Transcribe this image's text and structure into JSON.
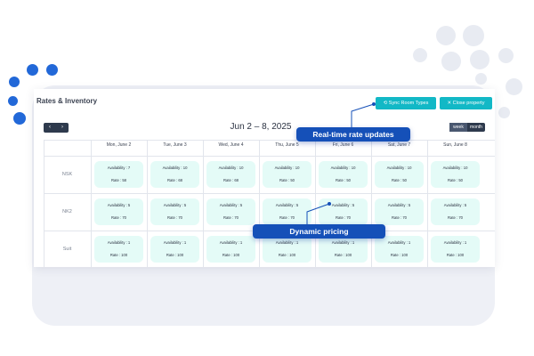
{
  "app": {
    "title": "Rates & Inventory",
    "sync_label": "⟲ Sync Room Types",
    "close_label": "✕ Close property"
  },
  "calendar": {
    "prev_icon": "‹",
    "next_icon": "›",
    "date_range": "Jun 2 – 8, 2025",
    "views": [
      "week",
      "month"
    ],
    "active_view": "week",
    "days": [
      "Mon, June 2",
      "Tue, June 3",
      "Wed, June 4",
      "Thu, June 5",
      "Fri, June 6",
      "Sat, June 7",
      "Sun, June 8"
    ]
  },
  "rows": [
    {
      "room": "NSK",
      "cells": [
        {
          "availability": "Availability : 7",
          "rate": "Rate : 58"
        },
        {
          "availability": "Availability : 10",
          "rate": "Rate : 68"
        },
        {
          "availability": "Availability : 10",
          "rate": "Rate : 68"
        },
        {
          "availability": "Availability : 10",
          "rate": "Rate : 50"
        },
        {
          "availability": "Availability : 10",
          "rate": "Rate : 50"
        },
        {
          "availability": "Availability : 10",
          "rate": "Rate : 50"
        },
        {
          "availability": "Availability : 10",
          "rate": "Rate : 50"
        }
      ]
    },
    {
      "room": "NK2",
      "cells": [
        {
          "availability": "Availability : 5",
          "rate": "Rate : 70"
        },
        {
          "availability": "Availability : 5",
          "rate": "Rate : 70"
        },
        {
          "availability": "Availability : 5",
          "rate": "Rate : 70"
        },
        {
          "availability": "Availability : 5",
          "rate": "Rate : 70"
        },
        {
          "availability": "Availability : 5",
          "rate": "Rate : 70"
        },
        {
          "availability": "Availability : 5",
          "rate": "Rate : 70"
        },
        {
          "availability": "Availability : 5",
          "rate": "Rate : 70"
        }
      ]
    },
    {
      "room": "Suit",
      "cells": [
        {
          "availability": "Availability : 1",
          "rate": "Rate : 100"
        },
        {
          "availability": "Availability : 1",
          "rate": "Rate : 100"
        },
        {
          "availability": "Availability : 1",
          "rate": "Rate : 100"
        },
        {
          "availability": "Availability : 1",
          "rate": "Rate : 100"
        },
        {
          "availability": "Availability : 1",
          "rate": "Rate : 100"
        },
        {
          "availability": "Availability : 1",
          "rate": "Rate : 100"
        },
        {
          "availability": "Availability : 1",
          "rate": "Rate : 100"
        }
      ]
    }
  ],
  "callouts": {
    "rate_updates": "Real-time rate updates",
    "dynamic_pricing": "Dynamic pricing"
  },
  "colors": {
    "accent": "#12b8c6",
    "callout": "#1550b8",
    "cell_bg": "#e4fbf7",
    "dark": "#2e3a4d"
  }
}
